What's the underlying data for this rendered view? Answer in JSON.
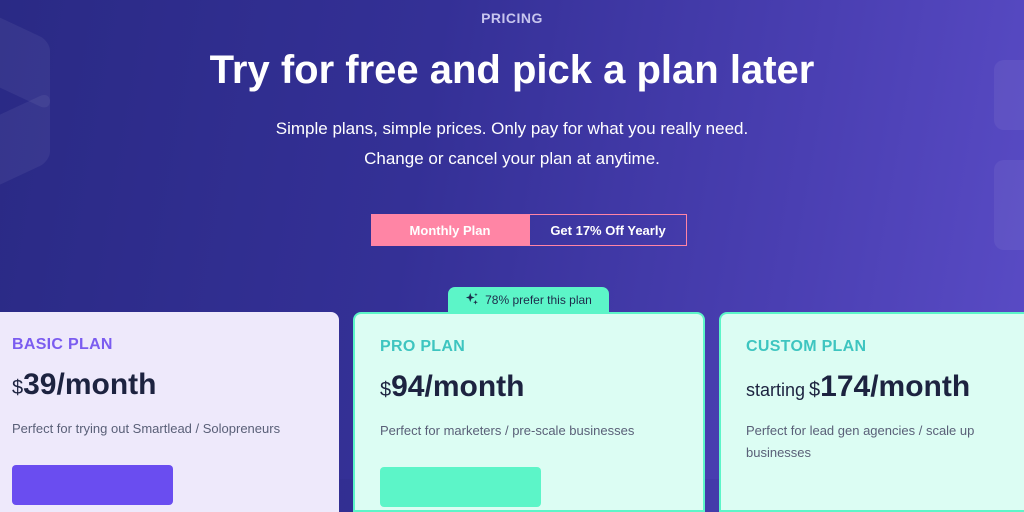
{
  "header": {
    "eyebrow": "PRICING",
    "title": "Try for free and pick a plan later",
    "subtitle_line1": "Simple plans, simple prices. Only pay for what you really need.",
    "subtitle_line2": "Change or cancel your plan at anytime."
  },
  "billing_toggle": {
    "monthly_label": "Monthly Plan",
    "yearly_label": "Get 17% Off Yearly",
    "selected": "Monthly Plan"
  },
  "popular_badge": {
    "icon": "sparkle-icon",
    "text": "78% prefer this plan"
  },
  "plans": [
    {
      "name": "BASIC PLAN",
      "prefix": "",
      "currency": "$",
      "amount": "39/month",
      "description": "Perfect for trying out Smartlead / Solopreneurs",
      "accent": "#7b5cf0"
    },
    {
      "name": "PRO PLAN",
      "prefix": "",
      "currency": "$",
      "amount": "94/month",
      "description": "Perfect for marketers / pre-scale businesses",
      "accent": "#3ec5c0"
    },
    {
      "name": "CUSTOM PLAN",
      "prefix": "starting",
      "currency": "$",
      "amount": "174/month",
      "description": "Perfect for lead gen agencies / scale up businesses",
      "accent": "#3ec5c0"
    }
  ],
  "colors": {
    "background": "#343096",
    "toggle_accent": "#ff85a5",
    "pro_accent": "#5cf5c8",
    "basic_button": "#6a4df0"
  }
}
